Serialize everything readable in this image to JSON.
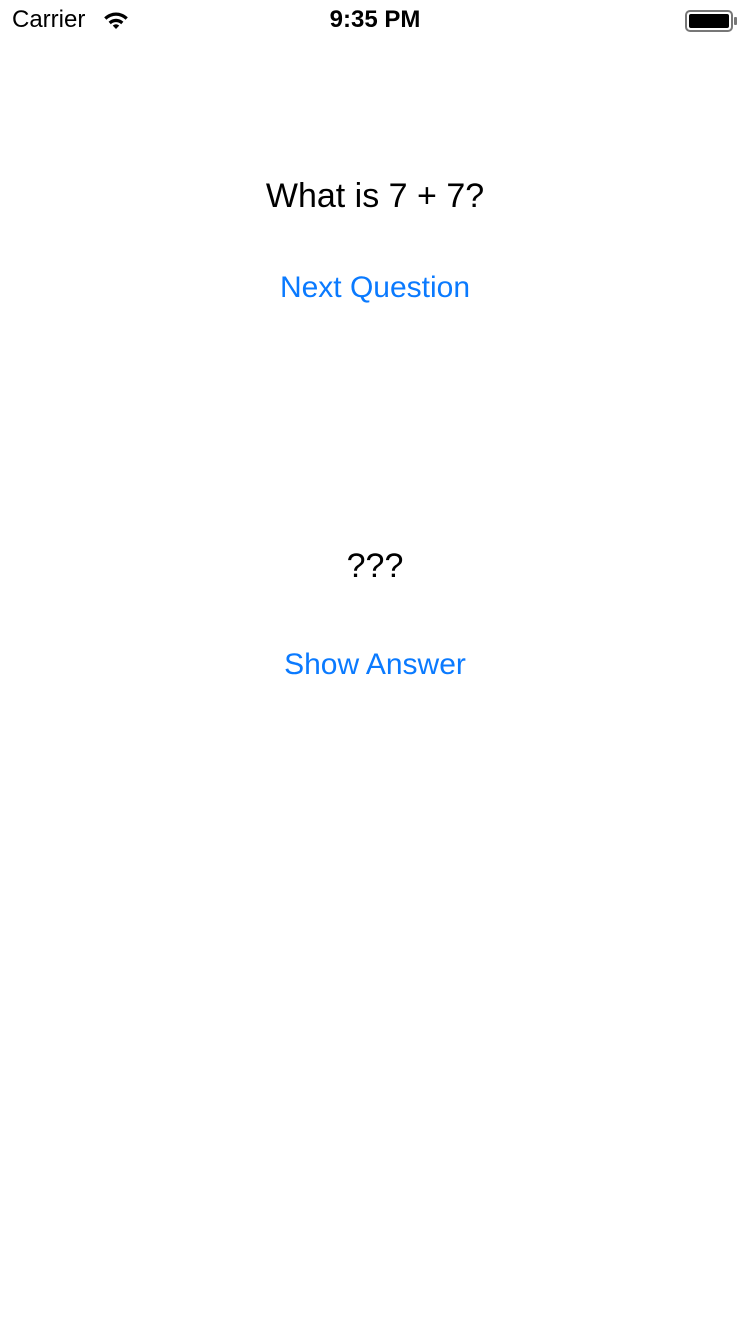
{
  "status_bar": {
    "carrier": "Carrier",
    "time": "9:35 PM",
    "wifi_icon": "wifi-icon",
    "battery_icon": "battery-icon"
  },
  "quiz": {
    "question": "What is 7 + 7?",
    "next_question_label": "Next Question",
    "answer": "???",
    "show_answer_label": "Show Answer"
  },
  "colors": {
    "accent": "#0a7aff",
    "text": "#000000",
    "background": "#ffffff"
  }
}
